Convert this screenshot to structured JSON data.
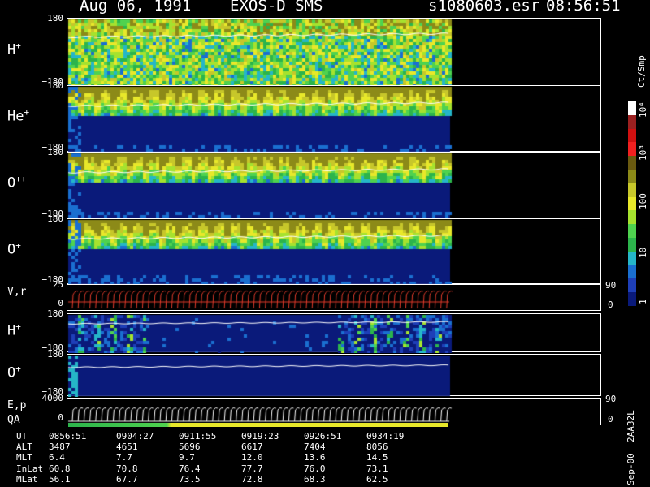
{
  "header": {
    "date": "Aug 06, 1991",
    "instrument": "EXOS-D SMS",
    "file": "s1080603.esr",
    "time": "08:56:51"
  },
  "colors": {
    "background": "#000000",
    "empty": "#0a1a7a",
    "velocity_traces": "#e23b2b",
    "trace_line": "#ffffff"
  },
  "panels": [
    {
      "id": "h-plus-top",
      "label": "H",
      "sup": "+",
      "ymax": "180",
      "ymin": "−180"
    },
    {
      "id": "he-plus",
      "label": "He",
      "sup": "+",
      "ymax": "180",
      "ymin": "−180"
    },
    {
      "id": "o-plusplus",
      "label": "O",
      "sup": "++",
      "ymax": "180",
      "ymin": "−180"
    },
    {
      "id": "o-plus-top",
      "label": "O",
      "sup": "+",
      "ymax": "180",
      "ymin": "−180"
    },
    {
      "id": "vr",
      "label": "V,r",
      "sup": "",
      "ymax": "25",
      "ymin": "0",
      "rmax": "90",
      "rmin": "0"
    },
    {
      "id": "h-plus-bot",
      "label": "H",
      "sup": "+",
      "ymax": "180",
      "ymin": "−180"
    },
    {
      "id": "o-plus-bot",
      "label": "O",
      "sup": "+",
      "ymax": "180",
      "ymin": "−180"
    },
    {
      "id": "ep",
      "label": "E,p",
      "sup": "",
      "ymax": "4000",
      "ymin": "0",
      "rmax": "90",
      "rmin": "0"
    }
  ],
  "qa_label": "QA",
  "colorbar": {
    "title": "Ct/Smp",
    "ticks": [
      "10⁴",
      "10³",
      "100",
      "10",
      "1"
    ],
    "stops": [
      "#ffffff",
      "#9b2020",
      "#d01010",
      "#f02020",
      "#6a5a10",
      "#8c8a18",
      "#c7c72a",
      "#e8e82a",
      "#a6e22e",
      "#4fd24f",
      "#2cb44c",
      "#25b6c8",
      "#1a6fd0",
      "#1e3fb8",
      "#0a1a7a"
    ]
  },
  "footer": {
    "rows": [
      {
        "label": "UT",
        "values": [
          "0856:51",
          "0904:27",
          "0911:55",
          "0919:23",
          "0926:51",
          "0934:19"
        ]
      },
      {
        "label": "ALT",
        "values": [
          "3487",
          "4651",
          "5696",
          "6617",
          "7404",
          "8056"
        ]
      },
      {
        "label": "MLT",
        "values": [
          "6.4",
          "7.7",
          "9.7",
          "12.0",
          "13.6",
          "14.5"
        ]
      },
      {
        "label": "InLat",
        "values": [
          "60.8",
          "70.8",
          "76.4",
          "77.7",
          "76.0",
          "73.1"
        ]
      },
      {
        "label": "MLat",
        "values": [
          "56.1",
          "67.7",
          "73.5",
          "72.8",
          "68.3",
          "62.5"
        ]
      }
    ],
    "side_note": "Sep-00  2AA32L"
  },
  "chart_data": {
    "type": "heatmap",
    "title": "Aug 06, 1991   EXOS-D SMS",
    "x_ticks_ut": [
      "0856:51",
      "0904:27",
      "0911:55",
      "0919:23",
      "0926:51",
      "0934:19"
    ],
    "panels": [
      "H+",
      "He+",
      "O++",
      "O+",
      "V,r",
      "H+",
      "O+",
      "E,p"
    ],
    "y_range_pitch": [
      -180,
      180
    ],
    "colorbar_unit": "Ct/Smp",
    "colorbar_range": [
      1,
      10000
    ],
    "colorbar_scale": "log"
  }
}
